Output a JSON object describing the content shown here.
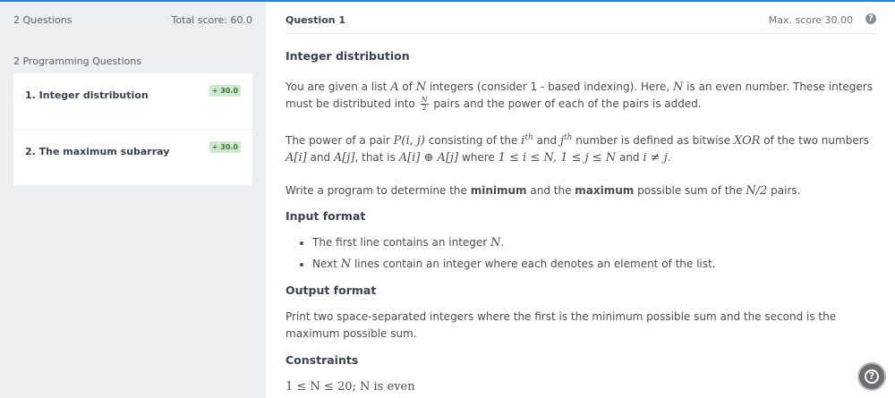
{
  "sidebar": {
    "questions_count": "2 Questions",
    "total_score": "Total score: 60.0",
    "section_title": "2 Programming Questions",
    "items": [
      {
        "label": "1. Integer distribution",
        "badge": "+ 30.0"
      },
      {
        "label": "2. The maximum subarray",
        "badge": "+ 30.0"
      }
    ]
  },
  "header": {
    "question_label": "Question  1",
    "max_score": "Max. score 30.00"
  },
  "problem": {
    "title": "Integer distribution",
    "p1": {
      "a": "You are given a list ",
      "m1": "A",
      "b": " of ",
      "m2": "N",
      "c": " integers (consider 1 - based indexing). Here, ",
      "m3": "N",
      "d": " is an even number. These integers must be distributed into ",
      "frac_num": "N",
      "frac_den": "2",
      "e": " pairs and the power of each of the pairs is added."
    },
    "p2": {
      "a": "The power of a pair ",
      "m1": "P(i, j)",
      "b": " consisting of the ",
      "m2": "i",
      "sup1": "th",
      "c": " and ",
      "m3": "j",
      "sup2": "th",
      "d": " number is defined as bitwise ",
      "m4": "XOR",
      "e": " of the two numbers ",
      "m5": "A[i]",
      "f": " and ",
      "m6": "A[j]",
      "g": ", that is ",
      "m7": "A[i] ⊕ A[j]",
      "h": " where ",
      "m8": "1 ≤ i ≤ N,  1 ≤ j ≤ N",
      "i": " and ",
      "m9": "i ≠ j",
      "j": "."
    },
    "p3": {
      "a": "Write a program to determine the ",
      "b1": "minimum",
      "b": " and the ",
      "b2": "maximum",
      "c": " possible sum of the ",
      "m1": "N/2",
      "d": " pairs."
    },
    "input_title": "Input format",
    "input_items": [
      {
        "a": "The first line contains an integer ",
        "m": "N",
        "b": "."
      },
      {
        "a": "Next ",
        "m": "N",
        "b": " lines contain an integer where each denotes an element of the list."
      }
    ],
    "output_title": "Output format",
    "output_text": "Print two space-separated integers where the first is the minimum possible sum and the second is the maximum possible sum.",
    "constraints_title": "Constraints",
    "constraint": "1 ≤ N ≤ 20;  N is even"
  },
  "icons": {
    "help": "question-circle-icon",
    "fab": "help-fab-icon"
  },
  "colors": {
    "accent": "#2e82c6",
    "sidebar_bg": "#eaeff2",
    "badge_bg": "#cfe8cf",
    "badge_text": "#3b7a3b"
  }
}
